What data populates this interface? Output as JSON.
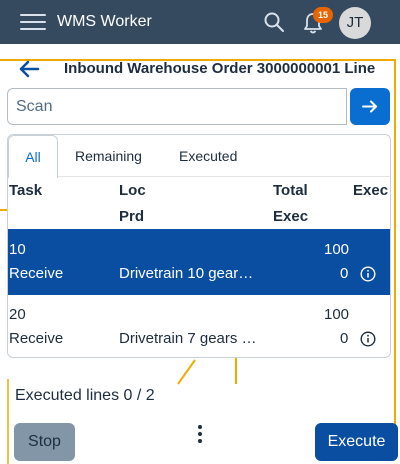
{
  "shell": {
    "app_title": "WMS Worker",
    "notification_count": "15",
    "avatar_initials": "JT",
    "icons": [
      "menu-icon",
      "search-icon",
      "bell-icon"
    ]
  },
  "page": {
    "title": "Inbound Warehouse Order 3000000001 Line"
  },
  "scan": {
    "placeholder": "Scan"
  },
  "tabs": [
    {
      "label": "All",
      "active": true
    },
    {
      "label": "Remaining",
      "active": false
    },
    {
      "label": "Executed",
      "active": false
    }
  ],
  "table": {
    "headers": {
      "task": "Task",
      "loc": "Loc",
      "prd": "Prd",
      "total": "Total",
      "exec_top": "Exec",
      "exec_bottom": "Exec"
    },
    "rows": [
      {
        "task": "10",
        "type": "Receive",
        "product": "Drivetrain 10 gear…",
        "total": "100",
        "exec": "0",
        "selected": true
      },
      {
        "task": "20",
        "type": "Receive",
        "product": "Drivetrain 7 gears …",
        "total": "100",
        "exec": "0",
        "selected": false
      }
    ]
  },
  "status": {
    "executed_lines": "Executed lines 0 / 2"
  },
  "footer": {
    "stop_label": "Stop",
    "execute_label": "Execute"
  },
  "colors": {
    "shell_bg": "#354a5f",
    "accent": "#0a6ed1",
    "selected_row": "#0a4ea1",
    "badge": "#e76500",
    "background_lines": "#f0ab00"
  }
}
